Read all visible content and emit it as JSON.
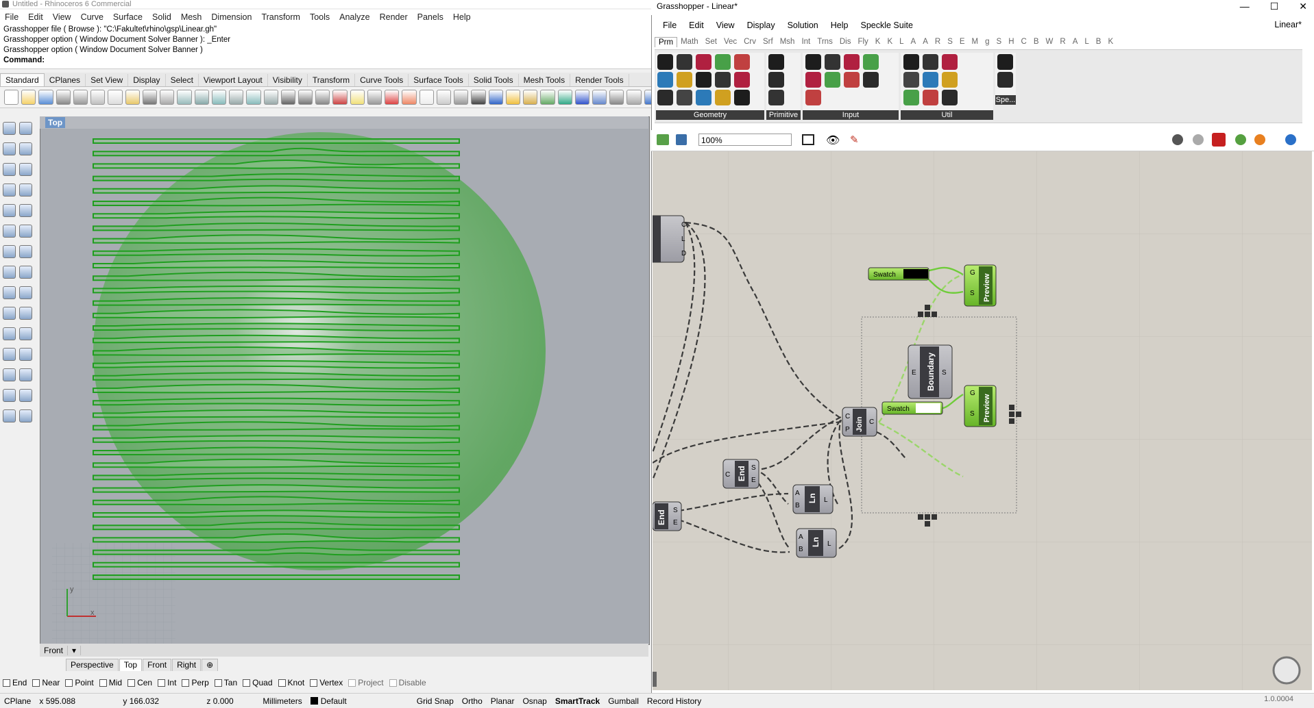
{
  "rhino": {
    "title": "Untitled - Rhinoceros 6 Commercial",
    "menu": [
      "File",
      "Edit",
      "View",
      "Curve",
      "Surface",
      "Solid",
      "Mesh",
      "Dimension",
      "Transform",
      "Tools",
      "Analyze",
      "Render",
      "Panels",
      "Help"
    ],
    "command_history": [
      "Grasshopper file ( Browse ): \"C:\\Fakultet\\rhino\\gsp\\Linear.gh\"",
      "Grasshopper option ( Window  Document  Solver  Banner ): _Enter",
      "Grasshopper option ( Window  Document  Solver  Banner )"
    ],
    "command_prompt": "Command:",
    "toolbar_tabs": [
      "Standard",
      "CPlanes",
      "Set View",
      "Display",
      "Select",
      "Viewport Layout",
      "Visibility",
      "Transform",
      "Curve Tools",
      "Surface Tools",
      "Solid Tools",
      "Mesh Tools",
      "Render Tools"
    ],
    "active_toolbar_tab": "Standard",
    "viewport_label": "Top",
    "front_label": "Front",
    "viewport_tabs": [
      "Perspective",
      "Top",
      "Front",
      "Right"
    ],
    "active_viewport_tab": "Top",
    "osnaps": [
      {
        "label": "End",
        "checked": false
      },
      {
        "label": "Near",
        "checked": false
      },
      {
        "label": "Point",
        "checked": false
      },
      {
        "label": "Mid",
        "checked": false
      },
      {
        "label": "Cen",
        "checked": false
      },
      {
        "label": "Int",
        "checked": false
      },
      {
        "label": "Perp",
        "checked": false
      },
      {
        "label": "Tan",
        "checked": false
      },
      {
        "label": "Quad",
        "checked": false
      },
      {
        "label": "Knot",
        "checked": false
      },
      {
        "label": "Vertex",
        "checked": false
      },
      {
        "label": "Project",
        "checked": false
      },
      {
        "label": "Disable",
        "checked": false
      }
    ],
    "status": {
      "cplane": "CPlane",
      "x": "x 595.088",
      "y": "y 166.032",
      "z": "z 0.000",
      "units": "Millimeters",
      "layer": "Default",
      "toggles": [
        "Grid Snap",
        "Ortho",
        "Planar",
        "Osnap",
        "SmartTrack",
        "Gumball",
        "Record History"
      ],
      "active_toggle": "SmartTrack"
    },
    "axis_x": "x",
    "axis_y": "y",
    "contour_color": "#1f9e1f"
  },
  "grasshopper": {
    "title": "Grasshopper - Linear*",
    "document_name": "Linear*",
    "menu": [
      "File",
      "Edit",
      "View",
      "Display",
      "Solution",
      "Help",
      "Speckle Suite"
    ],
    "tabs": [
      "Prm",
      "Math",
      "Set",
      "Vec",
      "Crv",
      "Srf",
      "Msh",
      "Int",
      "Trns",
      "Dis",
      "Fly",
      "K",
      "K",
      "L",
      "A",
      "A",
      "R",
      "S",
      "E",
      "M",
      "g",
      "S",
      "H",
      "C",
      "B",
      "W",
      "R",
      "A",
      "L",
      "B",
      "K"
    ],
    "active_tab": "Prm",
    "ribbon_groups": [
      "Geometry",
      "Primitive",
      "Input",
      "Util",
      "Spe..."
    ],
    "zoom": "100%",
    "version": "1.0.0004",
    "components": {
      "contour_outputs": [
        "C",
        "L",
        "D"
      ],
      "swatch1": "Swatch",
      "swatch2": "Swatch",
      "preview1": "Preview",
      "preview2": "Preview",
      "preview_inputs": [
        "G",
        "S"
      ],
      "boundary": "Boundary",
      "boundary_in": "E",
      "boundary_out": "S",
      "join": "Join",
      "join_in": [
        "C",
        "P"
      ],
      "join_out": "C",
      "end1": "End",
      "end2": "End",
      "end_in": "C",
      "end_out": [
        "S",
        "E"
      ],
      "line1": "Ln",
      "line2": "Ln",
      "line_in": [
        "A",
        "B"
      ],
      "line_out": "L"
    }
  }
}
